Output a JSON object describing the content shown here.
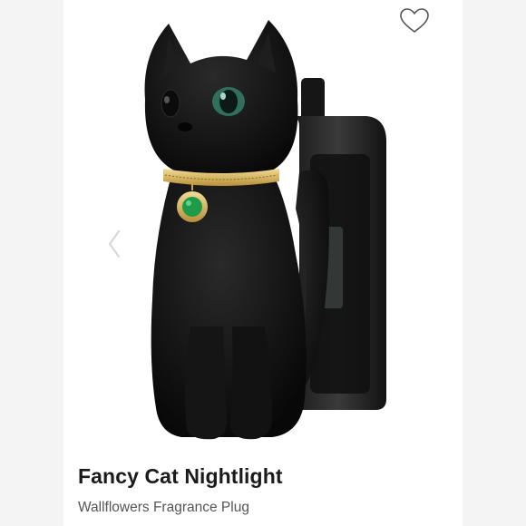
{
  "product": {
    "name": "Fancy Cat Nightlight",
    "subtitle": "Wallflowers Fragrance Plug"
  },
  "icons": {
    "favorite": "heart-outline-icon",
    "previous": "chevron-left-icon"
  },
  "colors": {
    "background": "#f4f4f4",
    "card": "#ffffff",
    "title": "#1b1b1b",
    "subtitle": "#555555",
    "gem": "#1f9a4a",
    "collar": "#d9b55a"
  }
}
